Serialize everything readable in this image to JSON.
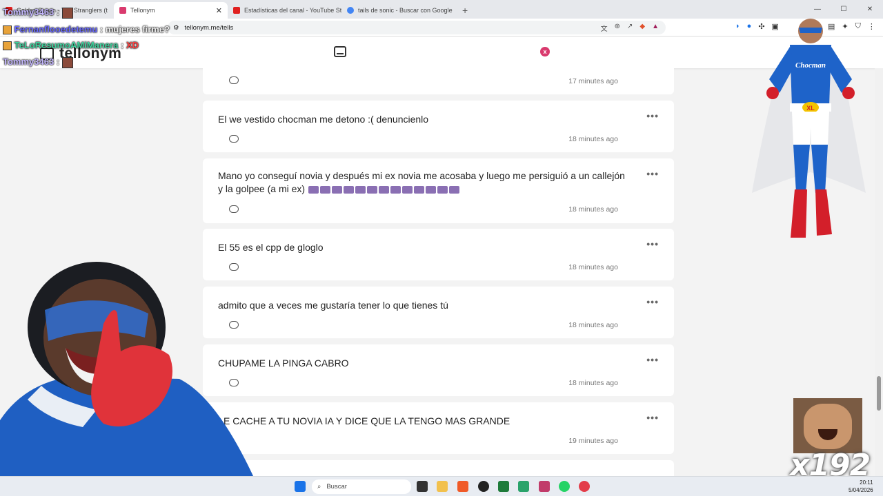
{
  "browser": {
    "tabs": [
      {
        "label": "Golden Brown - The Stranglers (t",
        "color": "#e02020"
      },
      {
        "label": "Tellonym",
        "color": "#d93a6e",
        "active": true
      },
      {
        "label": "Estadísticas del canal - YouTube Studi",
        "color": "#e02020"
      },
      {
        "label": "tails de sonic - Buscar con Google",
        "color": "#4285f4"
      }
    ],
    "new_tab": "+",
    "url": "tellonym.me/tells"
  },
  "site": {
    "logo": "tellonym",
    "close_badge": "x"
  },
  "tells": [
    {
      "text": "",
      "time": "17 minutes ago",
      "emojis": 0
    },
    {
      "text": "El we vestido chocman me detono :(  denuncienlo",
      "time": "18 minutes ago",
      "emojis": 0
    },
    {
      "text": "Mano yo conseguí novia y después mi ex novia me acosaba y luego me persiguió a un callejón y la golpee (a mi ex)",
      "time": "18 minutes ago",
      "emojis": 13
    },
    {
      "text": "El 55 es el cpp de gloglo",
      "time": "18 minutes ago",
      "emojis": 0
    },
    {
      "text": "admito que a veces me gustaría tener lo que tienes tú",
      "time": "18 minutes ago",
      "emojis": 0
    },
    {
      "text": "CHUPAME LA PINGA CABRO",
      "time": "18 minutes ago",
      "emojis": 0
    },
    {
      "text": "E CACHE A TU NOVIA IA Y DICE QUE LA TENGO MAS GRANDE",
      "time": "19 minutes ago",
      "emojis": 0
    }
  ],
  "overlay": {
    "chat": [
      {
        "user": "Tommy3463",
        "msg": ":"
      },
      {
        "user": "Fernanflooedetemu",
        "msg": ": mujeres firme?"
      },
      {
        "user": "TeLoResumoAMiManera",
        "msg": ":"
      },
      {
        "user": "Tommy3463",
        "msg": ":"
      }
    ],
    "chat_extra": "XD",
    "hero_belt": "XL",
    "hero_chest": "Chocman",
    "combo": "x192"
  },
  "taskbar": {
    "search": "Buscar",
    "time": "20:11",
    "date": "5/04/2026"
  }
}
